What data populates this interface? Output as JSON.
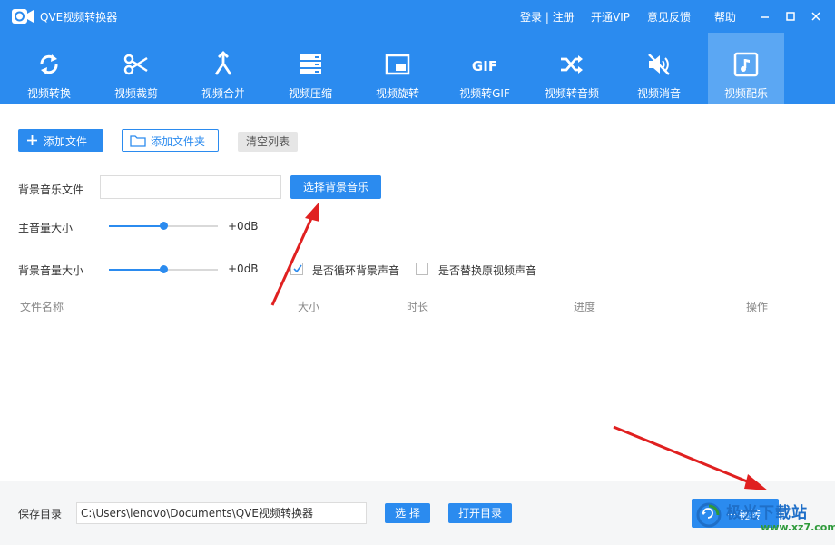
{
  "app": {
    "title": "QVE视频转换器",
    "accent": "#2b8bef"
  },
  "top_links": {
    "login": "登录 | 注册",
    "vip": "开通VIP",
    "feedback": "意见反馈",
    "help": "帮助"
  },
  "tools": [
    {
      "label": "视频转换",
      "icon": "refresh-icon"
    },
    {
      "label": "视频裁剪",
      "icon": "scissors-icon"
    },
    {
      "label": "视频合并",
      "icon": "merge-icon"
    },
    {
      "label": "视频压缩",
      "icon": "compress-icon"
    },
    {
      "label": "视频旋转",
      "icon": "rotate-icon"
    },
    {
      "label": "视频转GIF",
      "icon": "gif-icon"
    },
    {
      "label": "视频转音频",
      "icon": "shuffle-icon"
    },
    {
      "label": "视频消音",
      "icon": "mute-icon"
    },
    {
      "label": "视频配乐",
      "icon": "music-note-icon"
    }
  ],
  "actions": {
    "add_file": "添加文件",
    "add_folder": "添加文件夹",
    "clear_list": "清空列表"
  },
  "bgm": {
    "label": "背景音乐文件",
    "value": "",
    "choose_button": "选择背景音乐"
  },
  "main_volume": {
    "label": "主音量大小",
    "value_text": "+0dB",
    "level_percent": 50
  },
  "bg_volume": {
    "label": "背景音量大小",
    "value_text": "+0dB",
    "level_percent": 50
  },
  "options": {
    "loop_label": "是否循环背景声音",
    "loop_checked": true,
    "replace_label": "是否替换原视频声音",
    "replace_checked": false
  },
  "table": {
    "columns": [
      "文件名称",
      "大小",
      "时长",
      "进度",
      "操作"
    ]
  },
  "footer": {
    "save_label": "保存目录",
    "save_path": "C:\\Users\\lenovo\\Documents\\QVE视频转换器",
    "choose_button": "选 择",
    "open_button": "打开目录",
    "start_button": "一键转"
  },
  "watermark": {
    "text": "极光下载站",
    "sub": "www.xz7.com"
  }
}
